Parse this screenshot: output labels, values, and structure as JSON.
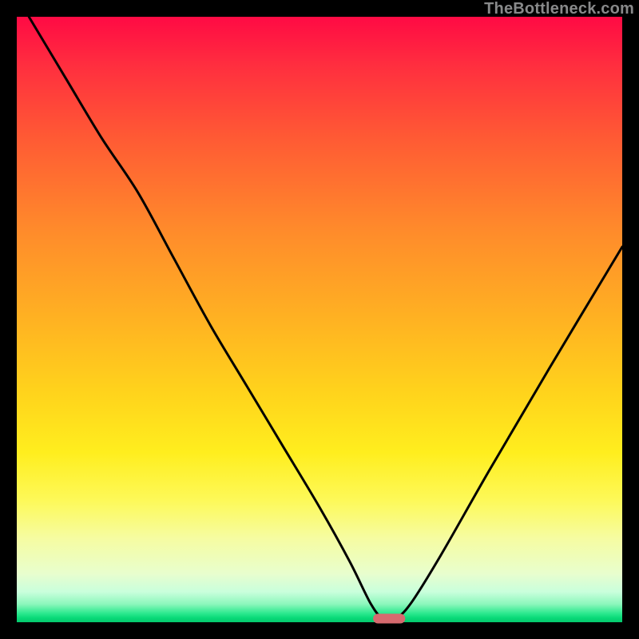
{
  "watermark": "TheBottleneck.com",
  "colors": {
    "pill": "#d66a6f",
    "curve": "#000000"
  },
  "chart_data": {
    "type": "line",
    "title": "",
    "xlabel": "",
    "ylabel": "",
    "xlim": [
      0,
      100
    ],
    "ylim": [
      0,
      100
    ],
    "grid": false,
    "series": [
      {
        "name": "bottleneck-curve",
        "x": [
          2,
          8,
          14,
          20,
          26,
          32,
          38,
          44,
          50,
          55,
          58.5,
          60.5,
          62.5,
          65,
          70,
          78,
          88,
          100
        ],
        "y": [
          100,
          90,
          80,
          71,
          60,
          49,
          39,
          29,
          19,
          10,
          3,
          0.6,
          0.6,
          3,
          11,
          25,
          42,
          62
        ]
      }
    ],
    "marker": {
      "name": "optimal-pill",
      "x_center": 61.5,
      "y_center": 0.6,
      "width": 5.3,
      "height": 1.6
    }
  }
}
